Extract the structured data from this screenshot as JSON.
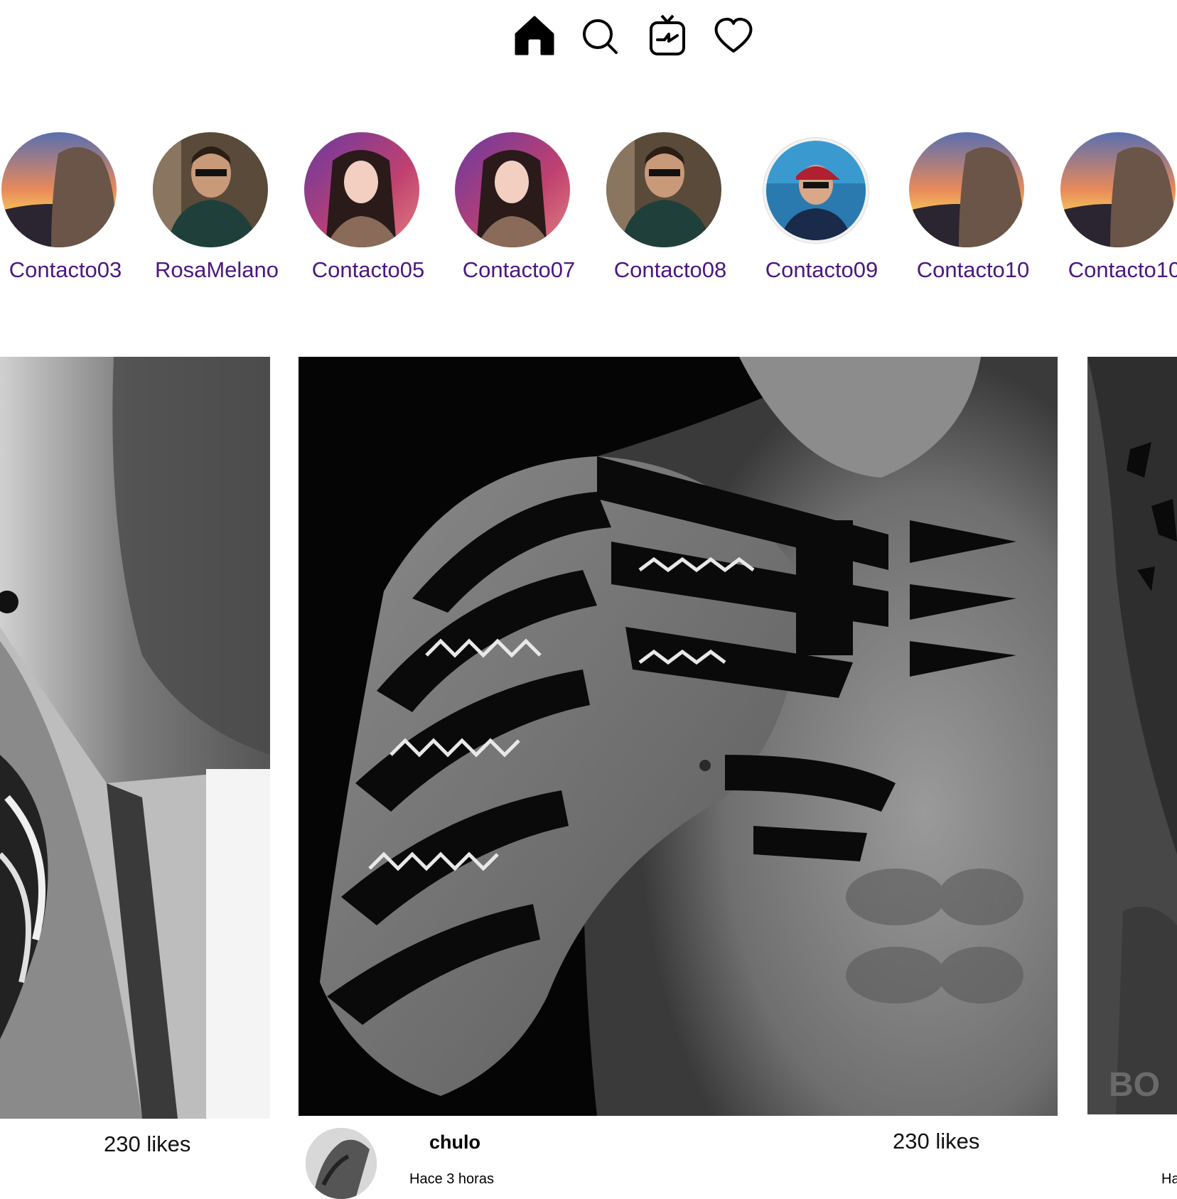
{
  "nav": {
    "items": [
      {
        "icon": "home-icon"
      },
      {
        "icon": "search-icon"
      },
      {
        "icon": "igtv-icon"
      },
      {
        "icon": "heart-icon"
      }
    ]
  },
  "stories": [
    {
      "name": "Contacto03"
    },
    {
      "name": "RosaMelano"
    },
    {
      "name": "Contacto05"
    },
    {
      "name": "Contacto07"
    },
    {
      "name": "Contacto08"
    },
    {
      "name": "Contacto09"
    },
    {
      "name": "Contacto10"
    },
    {
      "name": "Contacto10"
    }
  ],
  "posts": [
    {
      "likes": "230 likes"
    },
    {
      "author": "chulo",
      "time": "Hace 3 horas",
      "likes": "230 likes"
    },
    {
      "time_partial": "Ha"
    }
  ],
  "colors": {
    "story_name": "#4b1780",
    "background": "#ffffff"
  }
}
